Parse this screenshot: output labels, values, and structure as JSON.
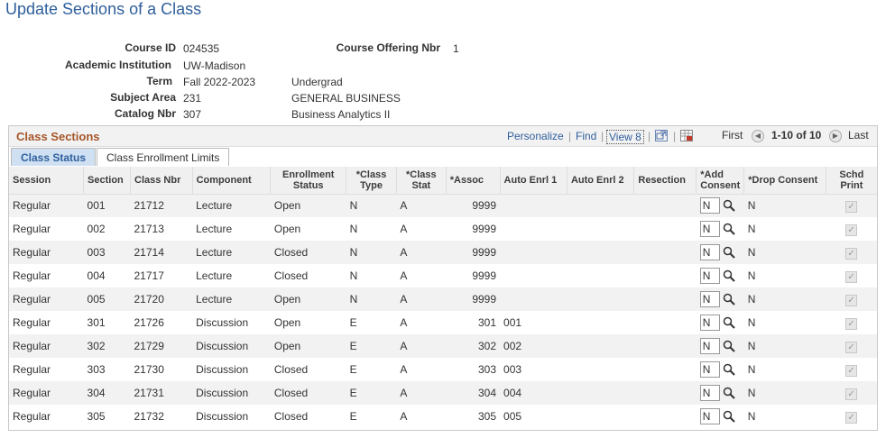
{
  "page_title": "Update Sections of a Class",
  "info": {
    "course_id_label": "Course ID",
    "course_id": "024535",
    "course_offering_label": "Course Offering Nbr",
    "course_offering": "1",
    "institution_label": "Academic Institution",
    "institution": "UW-Madison",
    "term_label": "Term",
    "term": "Fall 2022-2023",
    "term_career": "Undergrad",
    "subject_label": "Subject Area",
    "subject": "231",
    "subject_desc": "GENERAL BUSINESS",
    "catalog_label": "Catalog Nbr",
    "catalog": "307",
    "catalog_desc": "Business Analytics II"
  },
  "grid": {
    "title": "Class Sections",
    "personalize": "Personalize",
    "find": "Find",
    "view": "View 8",
    "first": "First",
    "range": "1-10 of 10",
    "last": "Last",
    "tabs": [
      "Class Status",
      "Class Enrollment Limits"
    ],
    "columns": [
      "Session",
      "Section",
      "Class Nbr",
      "Component",
      "Enrollment Status",
      "*Class Type",
      "*Class Stat",
      "*Assoc",
      "Auto Enrl 1",
      "Auto Enrl 2",
      "Resection",
      "*Add Consent",
      "*Drop Consent",
      "Schd Print"
    ],
    "rows": [
      {
        "session": "Regular",
        "section": "001",
        "class_nbr": "21712",
        "component": "Lecture",
        "status": "Open",
        "type": "N",
        "stat": "A",
        "assoc": "9999",
        "auto1": "",
        "add": "N",
        "drop": "N"
      },
      {
        "session": "Regular",
        "section": "002",
        "class_nbr": "21713",
        "component": "Lecture",
        "status": "Open",
        "type": "N",
        "stat": "A",
        "assoc": "9999",
        "auto1": "",
        "add": "N",
        "drop": "N"
      },
      {
        "session": "Regular",
        "section": "003",
        "class_nbr": "21714",
        "component": "Lecture",
        "status": "Closed",
        "type": "N",
        "stat": "A",
        "assoc": "9999",
        "auto1": "",
        "add": "N",
        "drop": "N"
      },
      {
        "session": "Regular",
        "section": "004",
        "class_nbr": "21717",
        "component": "Lecture",
        "status": "Closed",
        "type": "N",
        "stat": "A",
        "assoc": "9999",
        "auto1": "",
        "add": "N",
        "drop": "N"
      },
      {
        "session": "Regular",
        "section": "005",
        "class_nbr": "21720",
        "component": "Lecture",
        "status": "Open",
        "type": "N",
        "stat": "A",
        "assoc": "9999",
        "auto1": "",
        "add": "N",
        "drop": "N"
      },
      {
        "session": "Regular",
        "section": "301",
        "class_nbr": "21726",
        "component": "Discussion",
        "status": "Open",
        "type": "E",
        "stat": "A",
        "assoc": "301",
        "auto1": "001",
        "add": "N",
        "drop": "N"
      },
      {
        "session": "Regular",
        "section": "302",
        "class_nbr": "21729",
        "component": "Discussion",
        "status": "Open",
        "type": "E",
        "stat": "A",
        "assoc": "302",
        "auto1": "002",
        "add": "N",
        "drop": "N"
      },
      {
        "session": "Regular",
        "section": "303",
        "class_nbr": "21730",
        "component": "Discussion",
        "status": "Closed",
        "type": "E",
        "stat": "A",
        "assoc": "303",
        "auto1": "003",
        "add": "N",
        "drop": "N"
      },
      {
        "session": "Regular",
        "section": "304",
        "class_nbr": "21731",
        "component": "Discussion",
        "status": "Closed",
        "type": "E",
        "stat": "A",
        "assoc": "304",
        "auto1": "004",
        "add": "N",
        "drop": "N"
      },
      {
        "session": "Regular",
        "section": "305",
        "class_nbr": "21732",
        "component": "Discussion",
        "status": "Closed",
        "type": "E",
        "stat": "A",
        "assoc": "305",
        "auto1": "005",
        "add": "N",
        "drop": "N"
      }
    ]
  }
}
